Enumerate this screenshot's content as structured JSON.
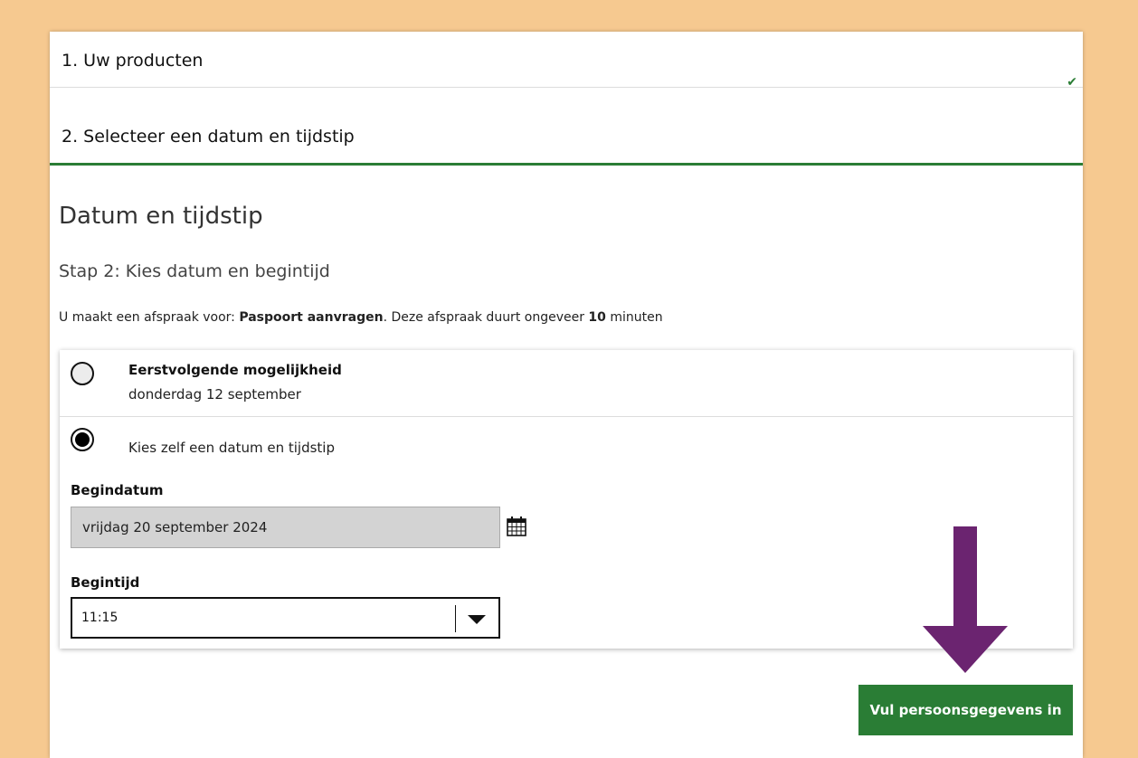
{
  "steps": {
    "step1_label": "1. Uw producten",
    "step1_status_icon": "check-icon",
    "step2_label": "2. Selecteer een datum en tijdstip"
  },
  "main": {
    "title": "Datum en tijdstip",
    "subtitle": "Stap 2: Kies datum en begintijd",
    "info_prefix": "U maakt een afspraak voor: ",
    "info_product": "Paspoort aanvragen",
    "info_middle": ". Deze afspraak duurt ongeveer ",
    "info_duration": "10",
    "info_suffix": " minuten"
  },
  "options": {
    "first_available_title": "Eerstvolgende mogelijkheid",
    "first_available_date": "donderdag 12 september",
    "first_available_selected": false,
    "custom_label": "Kies zelf een datum en tijdstip",
    "custom_selected": true
  },
  "form": {
    "start_date_label": "Begindatum",
    "start_date_value": "vrijdag 20 september 2024",
    "start_time_label": "Begintijd",
    "start_time_value": "11:15"
  },
  "actions": {
    "submit_label": "Vul persoonsgegevens in"
  },
  "colors": {
    "frame": "#f6c990",
    "accent_green": "#2a7d35",
    "arrow_purple": "#6b2470"
  }
}
